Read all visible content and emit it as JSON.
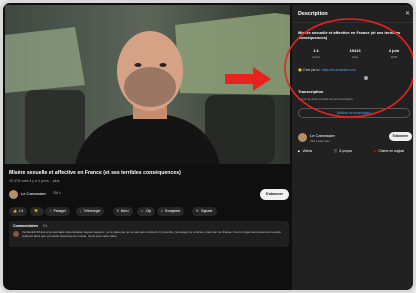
{
  "video": {
    "title": "Misère sexuelle et affective en France (et ses terribles conséquences)",
    "meta": "19 478 vues  il y a 4 jours  ...plus"
  },
  "channel": {
    "name": "Le Carnassier",
    "subscribers": "394 k",
    "subscribe_label": "S'abonner"
  },
  "actions": [
    {
      "icon": "like-icon",
      "glyph": "👍",
      "label": "1 k"
    },
    {
      "icon": "dislike-icon",
      "glyph": "👎",
      "label": ""
    },
    {
      "icon": "share-icon",
      "glyph": "↗",
      "label": "Partager"
    },
    {
      "icon": "download-icon",
      "glyph": "⤓",
      "label": "Télécharger"
    },
    {
      "icon": "thanks-icon",
      "glyph": "$",
      "label": "Merci"
    },
    {
      "icon": "clip-icon",
      "glyph": "✂",
      "label": "Clip"
    },
    {
      "icon": "save-icon",
      "glyph": "≡",
      "label": "Enregistrer"
    },
    {
      "icon": "report-icon",
      "glyph": "⚑",
      "label": "Signaler"
    }
  ],
  "comments": {
    "title": "Commentaires",
    "count": "5 k",
    "first": "J'ai bientôt 30 ans et je suis dans cette situation depuis toujours... je ne plais pas, je ne sais pas comment m'y prendre, j'ai essayé, je continue, mais rien ne change. C'est un sujet dont personne ne parle vraiment alors que ça touche beaucoup de monde, merci pour cette vidéo."
  },
  "panel": {
    "title": "Description",
    "close_glyph": "✕",
    "video_title": "Misère sexuelle et affective en France (et ses terribles conséquences)",
    "stats": [
      {
        "value": "1 k",
        "label": "J'aime"
      },
      {
        "value": "19413",
        "label": "Vues"
      },
      {
        "value": "4 juin",
        "label": "2025"
      }
    ],
    "desc_emoji": "😊",
    "desc_text": "C'est par ici : ",
    "desc_link": "https://lecarnassier.com",
    "transcript_title": "Transcription",
    "transcript_desc": "Suivez la vidéo à l'aide de la transcription.",
    "transcript_button": "Afficher la transcription",
    "channel_name": "Le Carnassier",
    "channel_subs": "394 k abonnés",
    "subscribe_label": "S'abonner",
    "links": [
      {
        "icon": "video-icon",
        "glyph": "▶",
        "label": "Vidéos"
      },
      {
        "icon": "about-icon",
        "glyph": "ⓘ",
        "label": "À propos"
      },
      {
        "icon": "youtube-icon",
        "glyph": "▶",
        "label": "Chaîne en anglais"
      }
    ]
  },
  "colors": {
    "annotation": "#e8221c",
    "link": "#3ea6ff",
    "background": "#0f0f0f"
  }
}
